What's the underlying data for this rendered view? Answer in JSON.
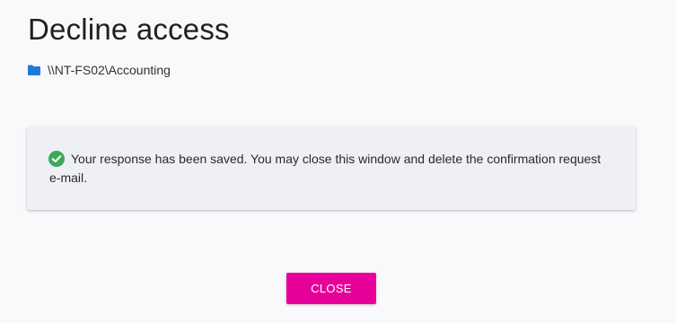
{
  "header": {
    "title": "Decline access"
  },
  "resource": {
    "icon": "folder-icon",
    "path": "\\\\NT-FS02\\Accounting"
  },
  "message": {
    "icon": "check-circle-icon",
    "text": "Your response has been saved. You may close this window and delete the confirmation request e-mail."
  },
  "actions": {
    "close_label": "CLOSE"
  },
  "colors": {
    "accent": "#e8009a",
    "success": "#3aaa5a",
    "folder": "#1f7ad6",
    "panel_background": "#eef0f3"
  }
}
